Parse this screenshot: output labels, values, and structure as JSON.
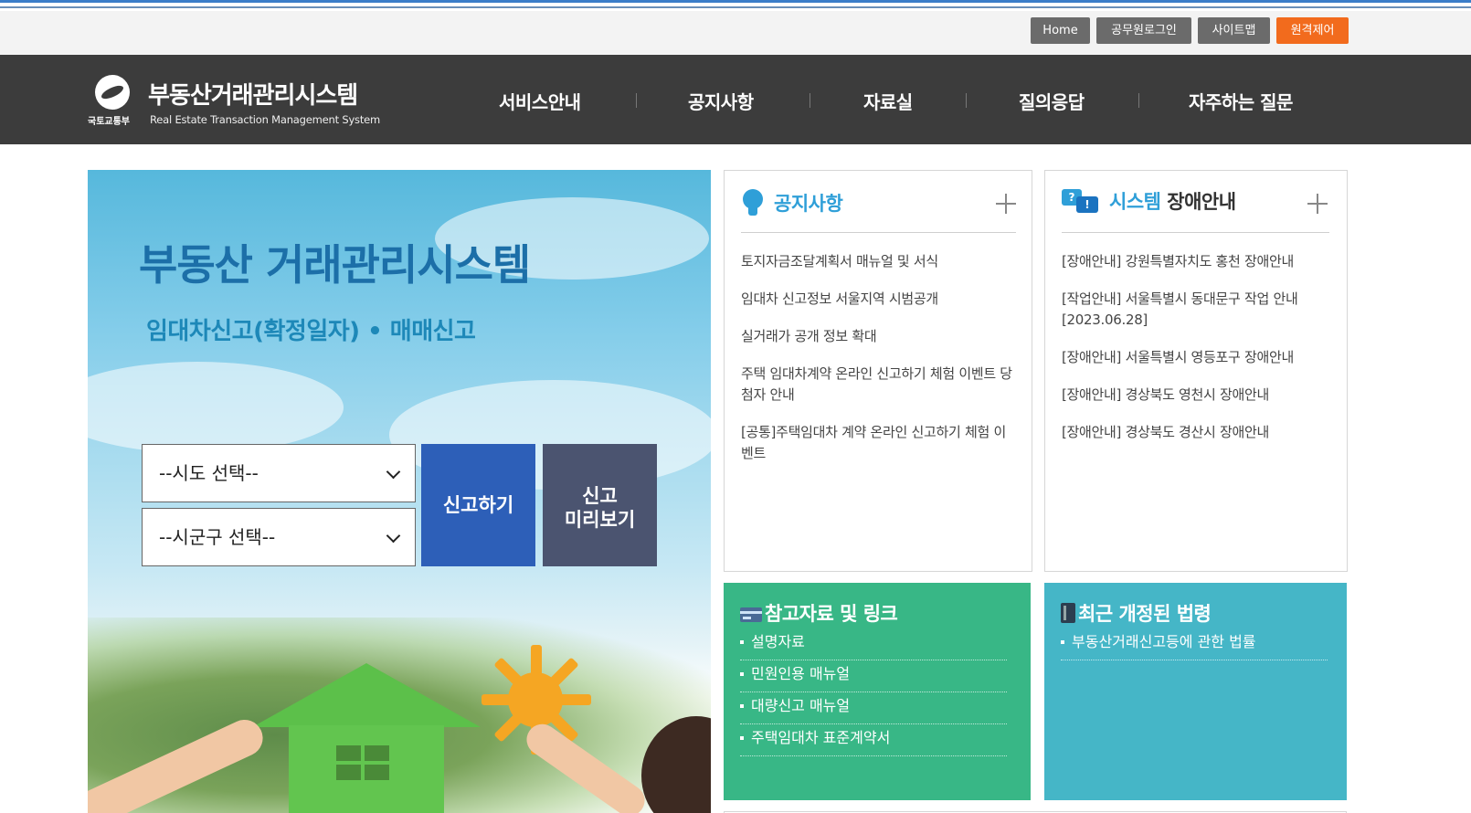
{
  "utility_bar": {
    "home": "Home",
    "staff_login": "공무원로그인",
    "sitemap": "사이트맵",
    "remote_control": "원격제어"
  },
  "header": {
    "ministry": "국토교통부",
    "title": "부동산거래관리시스템",
    "subtitle": "Real Estate Transaction Management System",
    "nav": [
      "서비스안내",
      "공지사항",
      "자료실",
      "질의응답",
      "자주하는 질문"
    ]
  },
  "hero": {
    "title": "부동산 거래관리시스템",
    "subtitle": "임대차신고(확정일자) • 매매신고",
    "sido_select": "--시도 선택--",
    "sigungu_select": "--시군구 선택--",
    "report_button": "신고하기",
    "preview_button_line1": "신고",
    "preview_button_line2": "미리보기"
  },
  "notice": {
    "title": "공지사항",
    "items": [
      "토지자금조달계획서 매뉴얼 및 서식",
      "임대차 신고정보 서울지역 시범공개",
      "실거래가 공개 정보 확대",
      "주택 임대차계약 온라인 신고하기 체험 이벤트 당첨자 안내",
      "[공통]주택임대차 계약 온라인 신고하기 체험 이벤트"
    ]
  },
  "system_outage": {
    "title_accent": "시스템",
    "title_rest": "장애안내",
    "items": [
      "[장애안내] 강원특별자치도 홍천 장애안내",
      "[작업안내] 서울특별시 동대문구 작업 안내 [2023.06.28]",
      "[장애안내] 서울특별시 영등포구 장애안내",
      "[장애안내] 경상북도 영천시 장애안내",
      "[장애안내] 경상북도 경산시 장애안내"
    ]
  },
  "reference_links": {
    "title": "참고자료 및 링크",
    "items": [
      "설명자료",
      "민원인용 매뉴얼",
      "대량신고 매뉴얼",
      "주택임대차 표준계약서"
    ]
  },
  "recent_laws": {
    "title": "최근 개정된 법령",
    "items": [
      "부동산거래신고등에 관한 법률"
    ]
  },
  "colors": {
    "nav_bg": "#3c3c3c",
    "accent_blue": "#2f9fd8",
    "orange": "#f26b1d",
    "green_panel": "#38b786",
    "teal_panel": "#45b6c7",
    "report_button": "#2d5fb8",
    "preview_button": "#4b5470"
  }
}
